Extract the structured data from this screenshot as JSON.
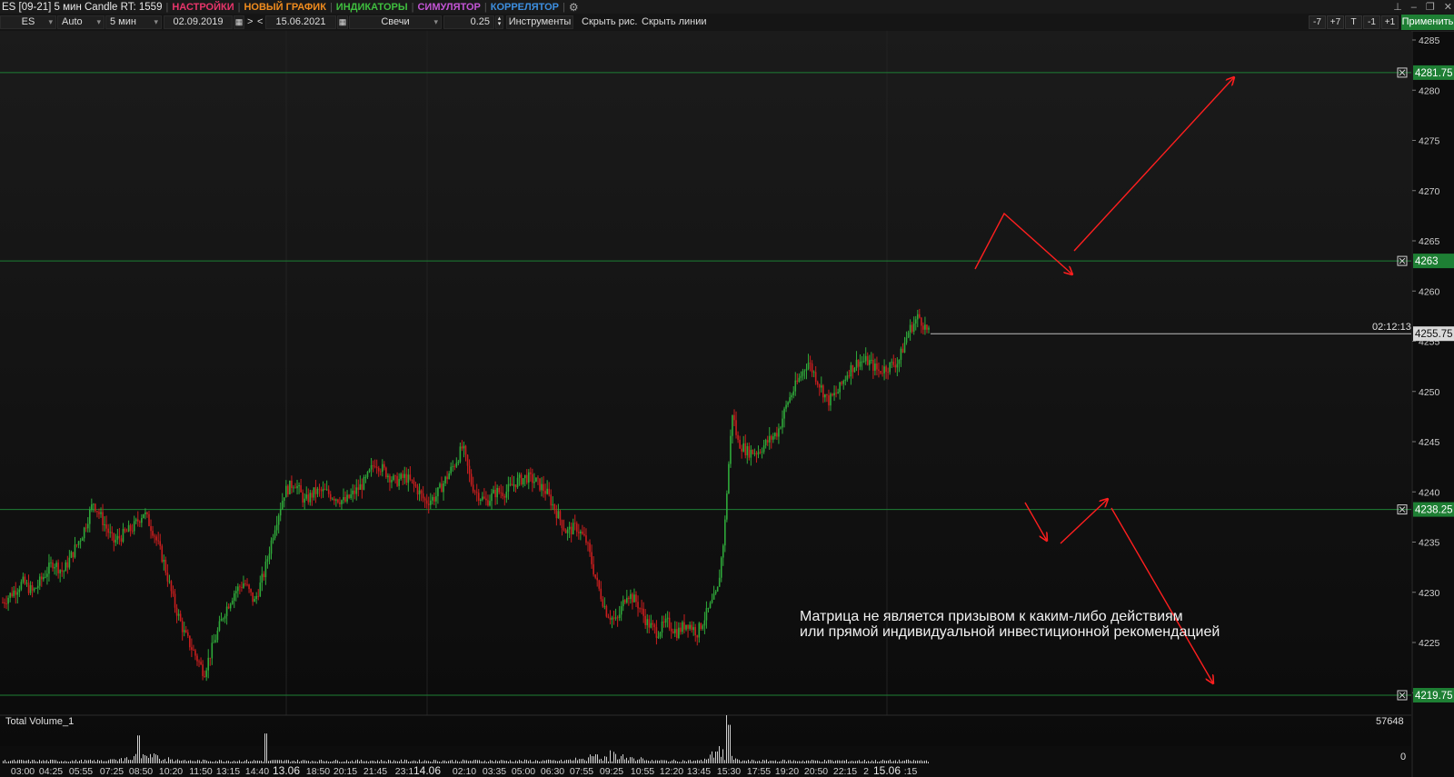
{
  "window": {
    "title": "ES [09-21] 5 мин Candle RT: 1559",
    "menus": [
      {
        "label": "НАСТРОЙКИ",
        "color": "#e8356b"
      },
      {
        "label": "НОВЫЙ ГРАФИК",
        "color": "#f08c1e"
      },
      {
        "label": "ИНДИКАТОРЫ",
        "color": "#3fbf3f"
      },
      {
        "label": "СИМУЛЯТОР",
        "color": "#c455d6"
      },
      {
        "label": "КОРРЕЛЯТОР",
        "color": "#3d8fe0"
      }
    ],
    "settings_icon": "gears-icon",
    "controls": [
      "pin-icon",
      "minimize-icon",
      "restore-icon",
      "close-icon"
    ]
  },
  "toolbar": {
    "symbol": "ES",
    "scale": "Auto",
    "timeframe": "5 мин",
    "date_from": "02.09.2019",
    "nav_next": ">",
    "nav_prev": "<",
    "date_to": "15.06.2021",
    "chart_type": "Свечи",
    "tick_size": "0.25",
    "instruments": "Инструменты",
    "hide_drawings": "Скрыть рис.",
    "hide_lines": "Скрыть линии",
    "shift_buttons": [
      "-7",
      "+7",
      "T",
      "-1",
      "+1"
    ],
    "apply": "Применить",
    "accent_color": "#1e7f34"
  },
  "chart_data": {
    "type": "candlestick",
    "symbol": "ES [09-21]",
    "interval": "5 мин",
    "y_axis": {
      "ticks": [
        4285,
        4280,
        4275,
        4270,
        4265,
        4260,
        4255,
        4250,
        4245,
        4240,
        4235,
        4230,
        4225,
        4220
      ],
      "range": [
        4217.5,
        4286.5
      ]
    },
    "x_tick_labels": [
      "03:00",
      "04:25",
      "05:55",
      "07:25",
      "08:50",
      "10:20",
      "11:50",
      "13:15",
      "14:40",
      "13.06",
      "18:50",
      "20:15",
      "21:45",
      "23:1",
      "14.06",
      "02:10",
      "03:35",
      "05:00",
      "06:30",
      "07:55",
      "09:25",
      "10:55",
      "12:20",
      "13:45",
      "15:30",
      "17:55",
      "19:20",
      "20:50",
      "22:15",
      "2",
      "15.06",
      ":15"
    ],
    "horizontal_levels": [
      {
        "value": 4281.75,
        "label": "4281.75",
        "color": "#1e7f34"
      },
      {
        "value": 4263,
        "label": "4263",
        "color": "#1e7f34"
      },
      {
        "value": 4238.25,
        "label": "4238.25",
        "color": "#1e7f34"
      },
      {
        "value": 4219.75,
        "label": "4219.75",
        "color": "#1e7f34"
      }
    ],
    "last_price": {
      "value": 4255.75,
      "label": "4255.75",
      "timer": "02:12:13"
    },
    "price_path": [
      [
        0,
        4229
      ],
      [
        2,
        4231
      ],
      [
        3,
        4230
      ],
      [
        5,
        4233
      ],
      [
        6,
        4232
      ],
      [
        8,
        4236
      ],
      [
        9,
        4239
      ],
      [
        11,
        4235
      ],
      [
        13,
        4236.5
      ],
      [
        14,
        4238
      ],
      [
        15,
        4236
      ],
      [
        16,
        4233
      ],
      [
        17,
        4229
      ],
      [
        18,
        4226
      ],
      [
        19,
        4224
      ],
      [
        20,
        4222
      ],
      [
        21,
        4225
      ],
      [
        22,
        4228
      ],
      [
        23,
        4230
      ],
      [
        24,
        4231
      ],
      [
        25,
        4229
      ],
      [
        26,
        4232
      ],
      [
        27,
        4236.5
      ],
      [
        28,
        4240
      ],
      [
        29,
        4241
      ],
      [
        30,
        4239
      ],
      [
        31,
        4240
      ],
      [
        32,
        4240
      ],
      [
        34,
        4239
      ],
      [
        36,
        4241
      ],
      [
        37,
        4243
      ],
      [
        38,
        4242
      ],
      [
        39,
        4241
      ],
      [
        40,
        4241.5
      ],
      [
        41,
        4240.5
      ],
      [
        42,
        4239
      ],
      [
        43,
        4239.5
      ],
      [
        45,
        4243
      ],
      [
        45.7,
        4244.5
      ],
      [
        46.5,
        4241
      ],
      [
        47,
        4240
      ],
      [
        48,
        4239
      ],
      [
        49,
        4240
      ],
      [
        50,
        4240
      ],
      [
        51,
        4241
      ],
      [
        52,
        4241.5
      ],
      [
        53,
        4241
      ],
      [
        54,
        4240
      ],
      [
        55,
        4238
      ],
      [
        56,
        4236
      ],
      [
        57,
        4236.5
      ],
      [
        58,
        4235
      ],
      [
        59,
        4231
      ],
      [
        60,
        4228
      ],
      [
        61,
        4227
      ],
      [
        62,
        4230
      ],
      [
        63,
        4229
      ],
      [
        64,
        4227
      ],
      [
        65,
        4226
      ],
      [
        66,
        4227
      ],
      [
        67,
        4226
      ],
      [
        68,
        4227
      ],
      [
        69,
        4226
      ],
      [
        70,
        4228
      ],
      [
        71,
        4230
      ],
      [
        71.7,
        4236
      ],
      [
        72,
        4241
      ],
      [
        72.5,
        4248
      ],
      [
        73,
        4245
      ],
      [
        74,
        4244
      ],
      [
        75,
        4244
      ],
      [
        76,
        4245
      ],
      [
        77,
        4246
      ],
      [
        78,
        4249
      ],
      [
        79,
        4251
      ],
      [
        80,
        4253
      ],
      [
        81,
        4251
      ],
      [
        82,
        4249
      ],
      [
        83,
        4250
      ],
      [
        84,
        4252
      ],
      [
        85,
        4253
      ],
      [
        86,
        4253
      ],
      [
        87,
        4252
      ],
      [
        88,
        4252.5
      ],
      [
        89,
        4253
      ],
      [
        90,
        4256
      ],
      [
        91,
        4257.5
      ],
      [
        92,
        4255.75
      ]
    ],
    "volume": {
      "label": "Total Volume_1",
      "max": 57648,
      "zero": "0"
    },
    "annotations": {
      "arrow_color": "#ff1f1f",
      "text_lines": [
        "Матрица не является призывом к каким-либо действиям",
        "или прямой индивидуальной инвестиционной рекомендацией"
      ]
    }
  }
}
